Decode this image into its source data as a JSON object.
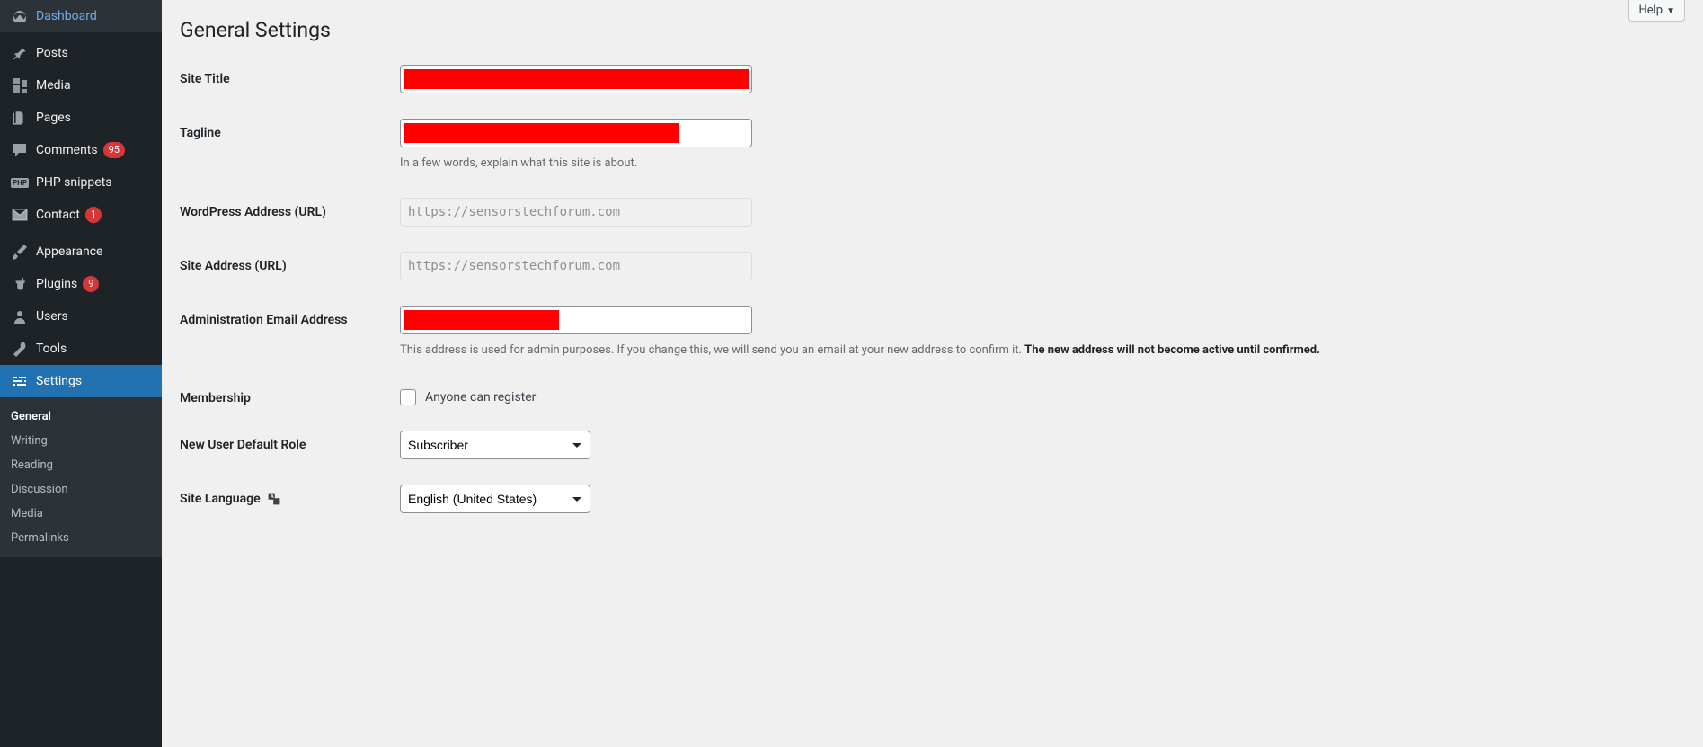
{
  "help_label": "Help",
  "page_title": "General Settings",
  "sidebar": {
    "items": [
      {
        "label": "Dashboard",
        "icon": "dashboard-icon",
        "badge": null
      },
      {
        "label": "Posts",
        "icon": "pin-icon",
        "badge": null
      },
      {
        "label": "Media",
        "icon": "media-icon",
        "badge": null
      },
      {
        "label": "Pages",
        "icon": "pages-icon",
        "badge": null
      },
      {
        "label": "Comments",
        "icon": "comment-icon",
        "badge": "95"
      },
      {
        "label": "PHP snippets",
        "icon": "php-icon",
        "badge": null
      },
      {
        "label": "Contact",
        "icon": "mail-icon",
        "badge": "1"
      },
      {
        "label": "Appearance",
        "icon": "brush-icon",
        "badge": null
      },
      {
        "label": "Plugins",
        "icon": "plugin-icon",
        "badge": "9"
      },
      {
        "label": "Users",
        "icon": "user-icon",
        "badge": null
      },
      {
        "label": "Tools",
        "icon": "wrench-icon",
        "badge": null
      },
      {
        "label": "Settings",
        "icon": "sliders-icon",
        "badge": null
      }
    ],
    "submenu": [
      {
        "label": "General",
        "active": true
      },
      {
        "label": "Writing",
        "active": false
      },
      {
        "label": "Reading",
        "active": false
      },
      {
        "label": "Discussion",
        "active": false
      },
      {
        "label": "Media",
        "active": false
      },
      {
        "label": "Permalinks",
        "active": false
      }
    ]
  },
  "form": {
    "site_title_label": "Site Title",
    "tagline_label": "Tagline",
    "tagline_desc": "In a few words, explain what this site is about.",
    "wp_address_label": "WordPress Address (URL)",
    "wp_address_value": "https://sensorstechforum.com",
    "site_address_label": "Site Address (URL)",
    "site_address_value": "https://sensorstechforum.com",
    "admin_email_label": "Administration Email Address",
    "admin_email_desc_1": "This address is used for admin purposes. If you change this, we will send you an email at your new address to confirm it. ",
    "admin_email_desc_2": "The new address will not become active until confirmed.",
    "membership_label": "Membership",
    "membership_checkbox_label": "Anyone can register",
    "default_role_label": "New User Default Role",
    "default_role_value": "Subscriber",
    "site_language_label": "Site Language",
    "site_language_value": "English (United States)"
  }
}
